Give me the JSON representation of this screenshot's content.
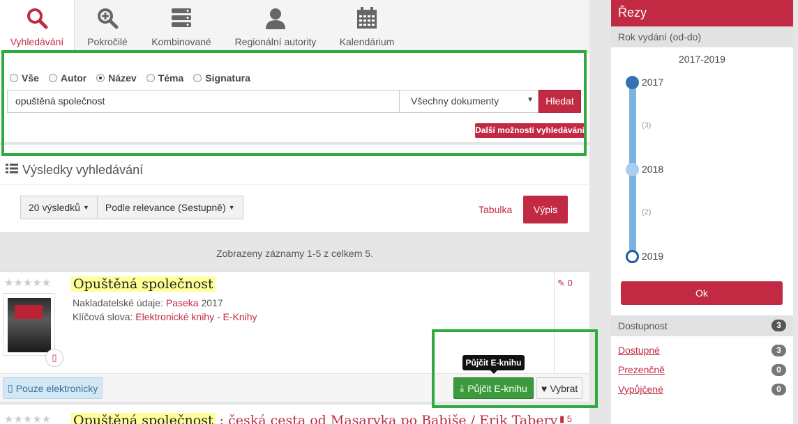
{
  "tabs": [
    {
      "label": "Vyhledávání",
      "icon": "search-icon",
      "active": true
    },
    {
      "label": "Pokročilé",
      "icon": "zoom-in-icon"
    },
    {
      "label": "Kombinované",
      "icon": "server-stack-icon"
    },
    {
      "label": "Regionální autority",
      "icon": "user-icon"
    },
    {
      "label": "Kalendárium",
      "icon": "calendar-icon"
    }
  ],
  "search": {
    "radios": [
      {
        "label": "Vše",
        "checked": false
      },
      {
        "label": "Autor",
        "checked": false
      },
      {
        "label": "Název",
        "checked": true
      },
      {
        "label": "Téma",
        "checked": false
      },
      {
        "label": "Signatura",
        "checked": false
      }
    ],
    "query": "opuštěná společnost",
    "doc_type": "Všechny dokumenty",
    "submit_label": "Hledat",
    "more_label": "Další možnosti vyhledávání"
  },
  "results": {
    "title": "Výsledky vyhledávání",
    "per_page": "20 výsledků",
    "sort": "Podle relevance (Sestupně)",
    "table_label": "Tabulka",
    "list_label": "Výpis",
    "summary": "Zobrazeny záznamy 1-5 z celkem 5."
  },
  "record1": {
    "stars": "★★★★★",
    "title": "Opuštěná  společnost",
    "publisher_label": "Nakladatelské údaje:",
    "publisher": "Paseka",
    "year": "2017",
    "keywords_label": "Klíčová slova:",
    "keywords": "Elektronické knihy - E-Knihy",
    "comments": "0",
    "electronic_label": "Pouze elektronicky",
    "borrow_label": "Půjčit E-knihu",
    "choose_label": "Vybrat",
    "tooltip": "Půjčit E-knihu"
  },
  "record2": {
    "stars": "★★★★★",
    "title_hl": "Opuštěná  společnost",
    "title_rest": " : česká cesta od Masaryka po Babiše / Erik Tabery",
    "count": "5"
  },
  "facets": {
    "header": "Řezy",
    "year_section": "Rok vydání (od-do)",
    "range": "2017-2019",
    "years": [
      "2017",
      "2018",
      "2019"
    ],
    "counts": [
      "(3)",
      "(2)"
    ],
    "ok_label": "Ok",
    "availability_section": "Dostupnost",
    "availability_total": "3",
    "availability_items": [
      {
        "label": "Dostupné",
        "count": "3"
      },
      {
        "label": "Prezenčně",
        "count": "0"
      },
      {
        "label": "Vypůjčené",
        "count": "0"
      }
    ]
  },
  "colors": {
    "accent": "#c22a44",
    "success": "#3b9a3b",
    "highlight": "#2eaa3e"
  }
}
